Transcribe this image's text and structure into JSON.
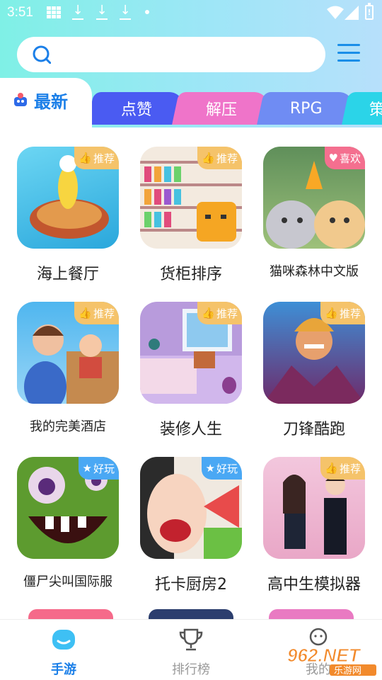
{
  "status_bar": {
    "time": "3:51"
  },
  "tabs": {
    "active": "最新",
    "items": [
      "点赞",
      "解压",
      "RPG",
      "策"
    ],
    "colors": [
      "#4a5bf2",
      "#ef74c9",
      "#6f8cf3",
      "#2bd4e8"
    ]
  },
  "games": [
    {
      "title": "海上餐厅",
      "badge": "推荐",
      "badge_type": "rec"
    },
    {
      "title": "货柜排序",
      "badge": "推荐",
      "badge_type": "rec"
    },
    {
      "title": "猫咪森林中文版",
      "badge": "喜欢",
      "badge_type": "like"
    },
    {
      "title": "我的完美酒店",
      "badge": "推荐",
      "badge_type": "rec"
    },
    {
      "title": "装修人生",
      "badge": "推荐",
      "badge_type": "rec"
    },
    {
      "title": "刀锋酷跑",
      "badge": "推荐",
      "badge_type": "rec"
    },
    {
      "title": "僵尸尖叫国际服",
      "badge": "好玩",
      "badge_type": "fun"
    },
    {
      "title": "托卡厨房2",
      "badge": "好玩",
      "badge_type": "fun"
    },
    {
      "title": "高中生模拟器",
      "badge": "推荐",
      "badge_type": "rec"
    }
  ],
  "bottom_nav": [
    {
      "label": "手游",
      "active": true
    },
    {
      "label": "排行榜",
      "active": false
    },
    {
      "label": "我的",
      "active": false
    }
  ],
  "watermark": {
    "logo": "962.NET",
    "caption": "乐游网"
  }
}
